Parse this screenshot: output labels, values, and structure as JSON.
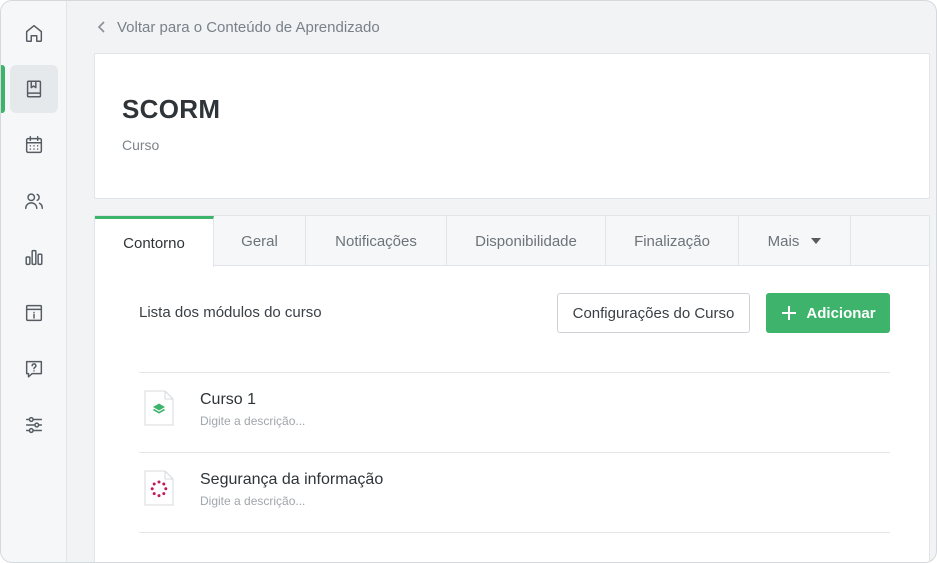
{
  "sidebar": {
    "items": [
      {
        "icon": "home-icon"
      },
      {
        "icon": "book-icon",
        "active": true
      },
      {
        "icon": "calendar-icon"
      },
      {
        "icon": "users-icon"
      },
      {
        "icon": "bar-chart-icon"
      },
      {
        "icon": "info-box-icon"
      },
      {
        "icon": "help-icon"
      },
      {
        "icon": "sliders-icon"
      }
    ],
    "accent_color": "#3db36b"
  },
  "back_link": {
    "label": "Voltar para o Conteúdo de Aprendizado"
  },
  "header": {
    "title": "SCORM",
    "subtitle": "Curso"
  },
  "tabs": [
    {
      "label": "Contorno",
      "active": true
    },
    {
      "label": "Geral"
    },
    {
      "label": "Notificações"
    },
    {
      "label": "Disponibilidade"
    },
    {
      "label": "Finalização"
    },
    {
      "label": "Mais"
    }
  ],
  "outline": {
    "list_label": "Lista dos módulos do curso",
    "settings_button": "Configurações do Curso",
    "add_button": "Adicionar",
    "modules": [
      {
        "title": "Curso 1",
        "description": "Digite a descrição...",
        "icon": "layers-icon",
        "icon_color": "#3db36b"
      },
      {
        "title": "Segurança da informação",
        "description": "Digite a descrição...",
        "icon": "scorm-burst-icon",
        "icon_color": "#c2185b"
      }
    ]
  }
}
